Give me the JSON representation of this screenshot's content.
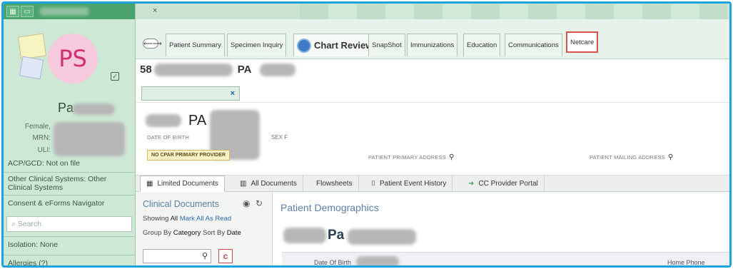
{
  "sidebar": {
    "avatar_initials": "PS",
    "patient_name": "Pa",
    "sex_label": "Female,",
    "mrn_label": "MRN:",
    "uli_label": "ULI:",
    "acp_line": "ACP/GCD: Not on file",
    "other_systems": "Other Clinical Systems: Other Clinical Systems",
    "consent_link": "Consent & eForms Navigator",
    "search_placeholder": "Search",
    "isolation": "Isolation: None",
    "allergies": "Allergies (?)"
  },
  "tabs": {
    "patient_summary": "Patient Summary",
    "specimen_inquiry": "Specimen Inquiry",
    "chart_review": "Chart Review",
    "snapshot": "SnapShot",
    "immunizations": "Immunizations",
    "education": "Education",
    "communications": "Communications",
    "netcare": "Netcare"
  },
  "header": {
    "mrn_prefix": "58",
    "name_suffix": "PA",
    "subtab_close": "×"
  },
  "patient_card": {
    "name_partial": "PA",
    "dob_label": "DATE OF BIRTH",
    "sex_label": "SEX F",
    "cpar_badge": "NO CPAR PRIMARY PROVIDER",
    "primary_address_label": "PATIENT PRIMARY ADDRESS",
    "mailing_address_label": "PATIENT MAILING ADDRESS"
  },
  "doc_tabs": {
    "limited": "Limited Documents",
    "all": "All Documents",
    "flowsheets": "Flowsheets",
    "event_history": "Patient Event History",
    "cc_portal": "CC Provider Portal"
  },
  "clinical_docs": {
    "title": "Clinical Documents",
    "showing_label": "Showing",
    "showing_value": "All",
    "mark_all": "Mark All As Read",
    "group_by_label": "Group By",
    "group_by_value": "Category",
    "sort_by_label": "Sort By",
    "sort_by_value": "Date",
    "c_button": "c"
  },
  "demographics": {
    "title": "Patient Demographics",
    "name_partial": "Pa",
    "dob_label": "Date Of Birth",
    "home_phone_label": "Home Phone"
  }
}
